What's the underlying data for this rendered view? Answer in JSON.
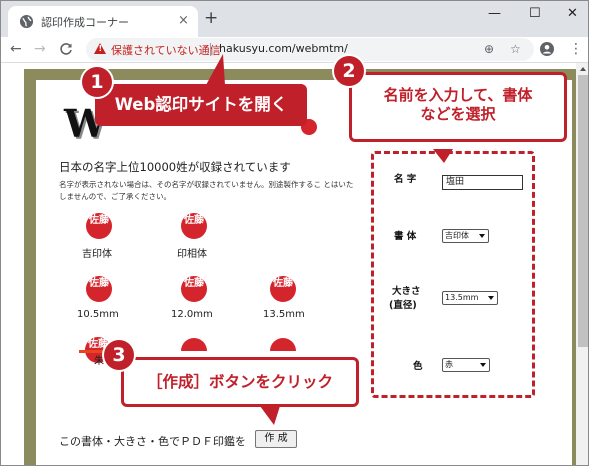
{
  "browser": {
    "tab_title": "認印作成コーナー",
    "tab_close": "×",
    "new_tab": "+",
    "win_min": "—",
    "win_max": "☐",
    "win_close": "✕",
    "nav_back": "←",
    "nav_forward": "→",
    "nav_reload": "C",
    "security_warning": "保護されていない通信",
    "url": "hakusyu.com/webmtm/",
    "zoom_icon": "⊕",
    "star_icon": "☆",
    "menu_icon": "⋮"
  },
  "page": {
    "logo_text": "W",
    "headline": "日本の名字上位10000姓が収録されています",
    "note": "名字が表示されない場合は、その名字が収録されていません。別途製作するこ とはいたしませんので、ご了承ください。",
    "seal_chars": "佐藤",
    "style_labels": [
      "吉印体",
      "印相体"
    ],
    "size_labels": [
      "10.5mm",
      "12.0mm",
      "13.5mm"
    ],
    "color_label": "朱",
    "bottom_text": "この書体・大きさ・色でＰＤＦ印鑑を",
    "make_button": "作 成"
  },
  "form": {
    "name_label": "名 字",
    "name_value": "塩田",
    "font_label": "書 体",
    "font_value": "吉印体",
    "size_label_1": "大きさ",
    "size_label_2": "(直径)",
    "size_value": "13.5mm",
    "color_label": "色",
    "color_value": "赤"
  },
  "callouts": {
    "step1_num": "1",
    "step1_text": "Web認印サイトを開く",
    "step2_num": "2",
    "step2_line1": "名前を入力して、書体",
    "step2_line2": "などを選択",
    "step3_num": "3",
    "step3_text": "［作成］ボタンをクリック"
  },
  "colors": {
    "accent_red": "#c0202a",
    "seal_red": "#d4242c",
    "frame_olive": "#8b8b5e"
  }
}
